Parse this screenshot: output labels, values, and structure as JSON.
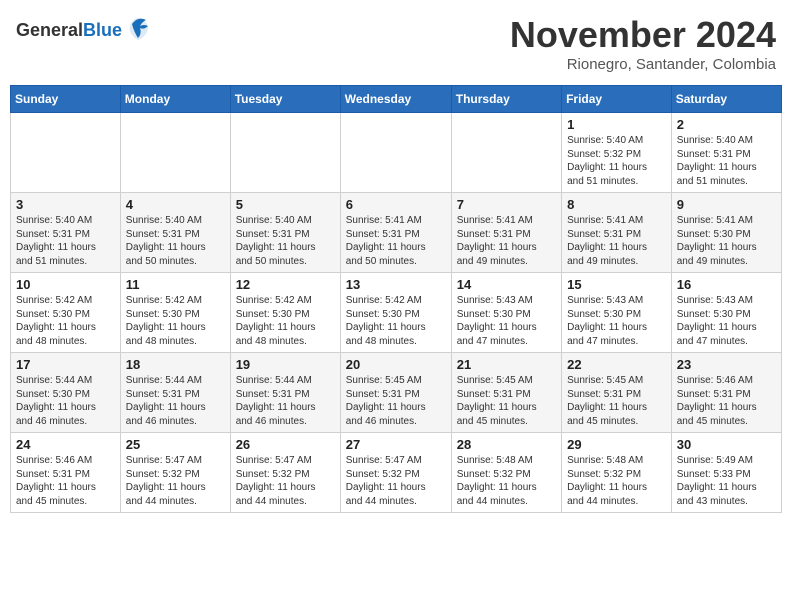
{
  "header": {
    "logo_general": "General",
    "logo_blue": "Blue",
    "month_year": "November 2024",
    "location": "Rionegro, Santander, Colombia"
  },
  "days_of_week": [
    "Sunday",
    "Monday",
    "Tuesday",
    "Wednesday",
    "Thursday",
    "Friday",
    "Saturday"
  ],
  "weeks": [
    [
      {
        "day": "",
        "info": ""
      },
      {
        "day": "",
        "info": ""
      },
      {
        "day": "",
        "info": ""
      },
      {
        "day": "",
        "info": ""
      },
      {
        "day": "",
        "info": ""
      },
      {
        "day": "1",
        "info": "Sunrise: 5:40 AM\nSunset: 5:32 PM\nDaylight: 11 hours\nand 51 minutes."
      },
      {
        "day": "2",
        "info": "Sunrise: 5:40 AM\nSunset: 5:31 PM\nDaylight: 11 hours\nand 51 minutes."
      }
    ],
    [
      {
        "day": "3",
        "info": "Sunrise: 5:40 AM\nSunset: 5:31 PM\nDaylight: 11 hours\nand 51 minutes."
      },
      {
        "day": "4",
        "info": "Sunrise: 5:40 AM\nSunset: 5:31 PM\nDaylight: 11 hours\nand 50 minutes."
      },
      {
        "day": "5",
        "info": "Sunrise: 5:40 AM\nSunset: 5:31 PM\nDaylight: 11 hours\nand 50 minutes."
      },
      {
        "day": "6",
        "info": "Sunrise: 5:41 AM\nSunset: 5:31 PM\nDaylight: 11 hours\nand 50 minutes."
      },
      {
        "day": "7",
        "info": "Sunrise: 5:41 AM\nSunset: 5:31 PM\nDaylight: 11 hours\nand 49 minutes."
      },
      {
        "day": "8",
        "info": "Sunrise: 5:41 AM\nSunset: 5:31 PM\nDaylight: 11 hours\nand 49 minutes."
      },
      {
        "day": "9",
        "info": "Sunrise: 5:41 AM\nSunset: 5:30 PM\nDaylight: 11 hours\nand 49 minutes."
      }
    ],
    [
      {
        "day": "10",
        "info": "Sunrise: 5:42 AM\nSunset: 5:30 PM\nDaylight: 11 hours\nand 48 minutes."
      },
      {
        "day": "11",
        "info": "Sunrise: 5:42 AM\nSunset: 5:30 PM\nDaylight: 11 hours\nand 48 minutes."
      },
      {
        "day": "12",
        "info": "Sunrise: 5:42 AM\nSunset: 5:30 PM\nDaylight: 11 hours\nand 48 minutes."
      },
      {
        "day": "13",
        "info": "Sunrise: 5:42 AM\nSunset: 5:30 PM\nDaylight: 11 hours\nand 48 minutes."
      },
      {
        "day": "14",
        "info": "Sunrise: 5:43 AM\nSunset: 5:30 PM\nDaylight: 11 hours\nand 47 minutes."
      },
      {
        "day": "15",
        "info": "Sunrise: 5:43 AM\nSunset: 5:30 PM\nDaylight: 11 hours\nand 47 minutes."
      },
      {
        "day": "16",
        "info": "Sunrise: 5:43 AM\nSunset: 5:30 PM\nDaylight: 11 hours\nand 47 minutes."
      }
    ],
    [
      {
        "day": "17",
        "info": "Sunrise: 5:44 AM\nSunset: 5:30 PM\nDaylight: 11 hours\nand 46 minutes."
      },
      {
        "day": "18",
        "info": "Sunrise: 5:44 AM\nSunset: 5:31 PM\nDaylight: 11 hours\nand 46 minutes."
      },
      {
        "day": "19",
        "info": "Sunrise: 5:44 AM\nSunset: 5:31 PM\nDaylight: 11 hours\nand 46 minutes."
      },
      {
        "day": "20",
        "info": "Sunrise: 5:45 AM\nSunset: 5:31 PM\nDaylight: 11 hours\nand 46 minutes."
      },
      {
        "day": "21",
        "info": "Sunrise: 5:45 AM\nSunset: 5:31 PM\nDaylight: 11 hours\nand 45 minutes."
      },
      {
        "day": "22",
        "info": "Sunrise: 5:45 AM\nSunset: 5:31 PM\nDaylight: 11 hours\nand 45 minutes."
      },
      {
        "day": "23",
        "info": "Sunrise: 5:46 AM\nSunset: 5:31 PM\nDaylight: 11 hours\nand 45 minutes."
      }
    ],
    [
      {
        "day": "24",
        "info": "Sunrise: 5:46 AM\nSunset: 5:31 PM\nDaylight: 11 hours\nand 45 minutes."
      },
      {
        "day": "25",
        "info": "Sunrise: 5:47 AM\nSunset: 5:32 PM\nDaylight: 11 hours\nand 44 minutes."
      },
      {
        "day": "26",
        "info": "Sunrise: 5:47 AM\nSunset: 5:32 PM\nDaylight: 11 hours\nand 44 minutes."
      },
      {
        "day": "27",
        "info": "Sunrise: 5:47 AM\nSunset: 5:32 PM\nDaylight: 11 hours\nand 44 minutes."
      },
      {
        "day": "28",
        "info": "Sunrise: 5:48 AM\nSunset: 5:32 PM\nDaylight: 11 hours\nand 44 minutes."
      },
      {
        "day": "29",
        "info": "Sunrise: 5:48 AM\nSunset: 5:32 PM\nDaylight: 11 hours\nand 44 minutes."
      },
      {
        "day": "30",
        "info": "Sunrise: 5:49 AM\nSunset: 5:33 PM\nDaylight: 11 hours\nand 43 minutes."
      }
    ]
  ]
}
